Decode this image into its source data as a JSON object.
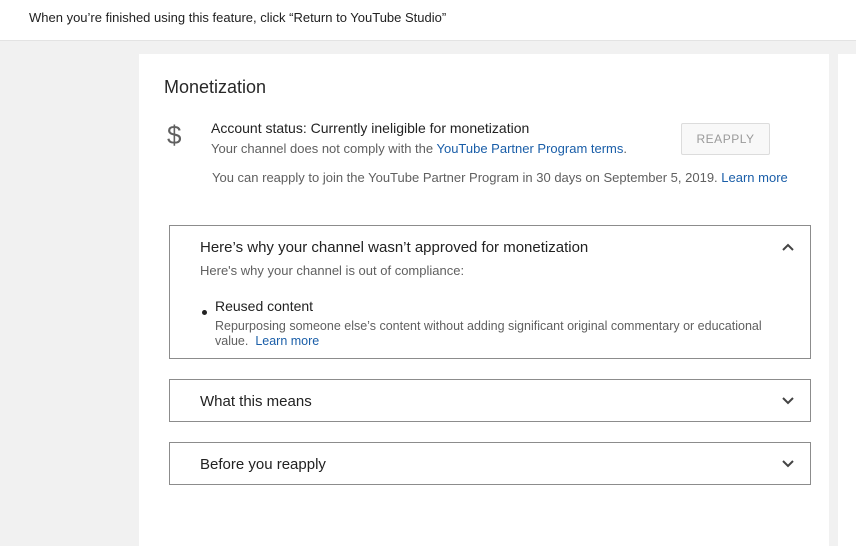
{
  "banner": {
    "message": "When you’re finished using this feature, click “Return to YouTube Studio”"
  },
  "monetization": {
    "title": "Monetization",
    "icon": "dollar-icon",
    "account_status": "Account status: Currently ineligible for monetization",
    "comply_prefix": "Your channel does not comply with the ",
    "comply_link": "YouTube Partner Program terms",
    "comply_suffix": ".",
    "reapply_button": "REAPPLY",
    "reapply_info_text": "You can reapply to join the YouTube Partner Program in 30 days on September 5, 2019.",
    "reapply_info_link": "Learn more"
  },
  "panels": [
    {
      "title": "Here’s why your channel wasn’t approved for monetization",
      "subtitle": "Here's why your channel is out of compliance:",
      "expanded": true,
      "reasons": [
        {
          "title": "Reused content",
          "description": "Repurposing someone else’s content without adding significant original commentary or educational value.",
          "link": "Learn more"
        }
      ]
    },
    {
      "title": "What this means",
      "expanded": false
    },
    {
      "title": "Before you reapply",
      "expanded": false
    }
  ],
  "colors": {
    "link": "#1a5ea8",
    "muted_text": "#606060",
    "panel_border": "#8c8c8c",
    "background": "#f1f1f1"
  }
}
